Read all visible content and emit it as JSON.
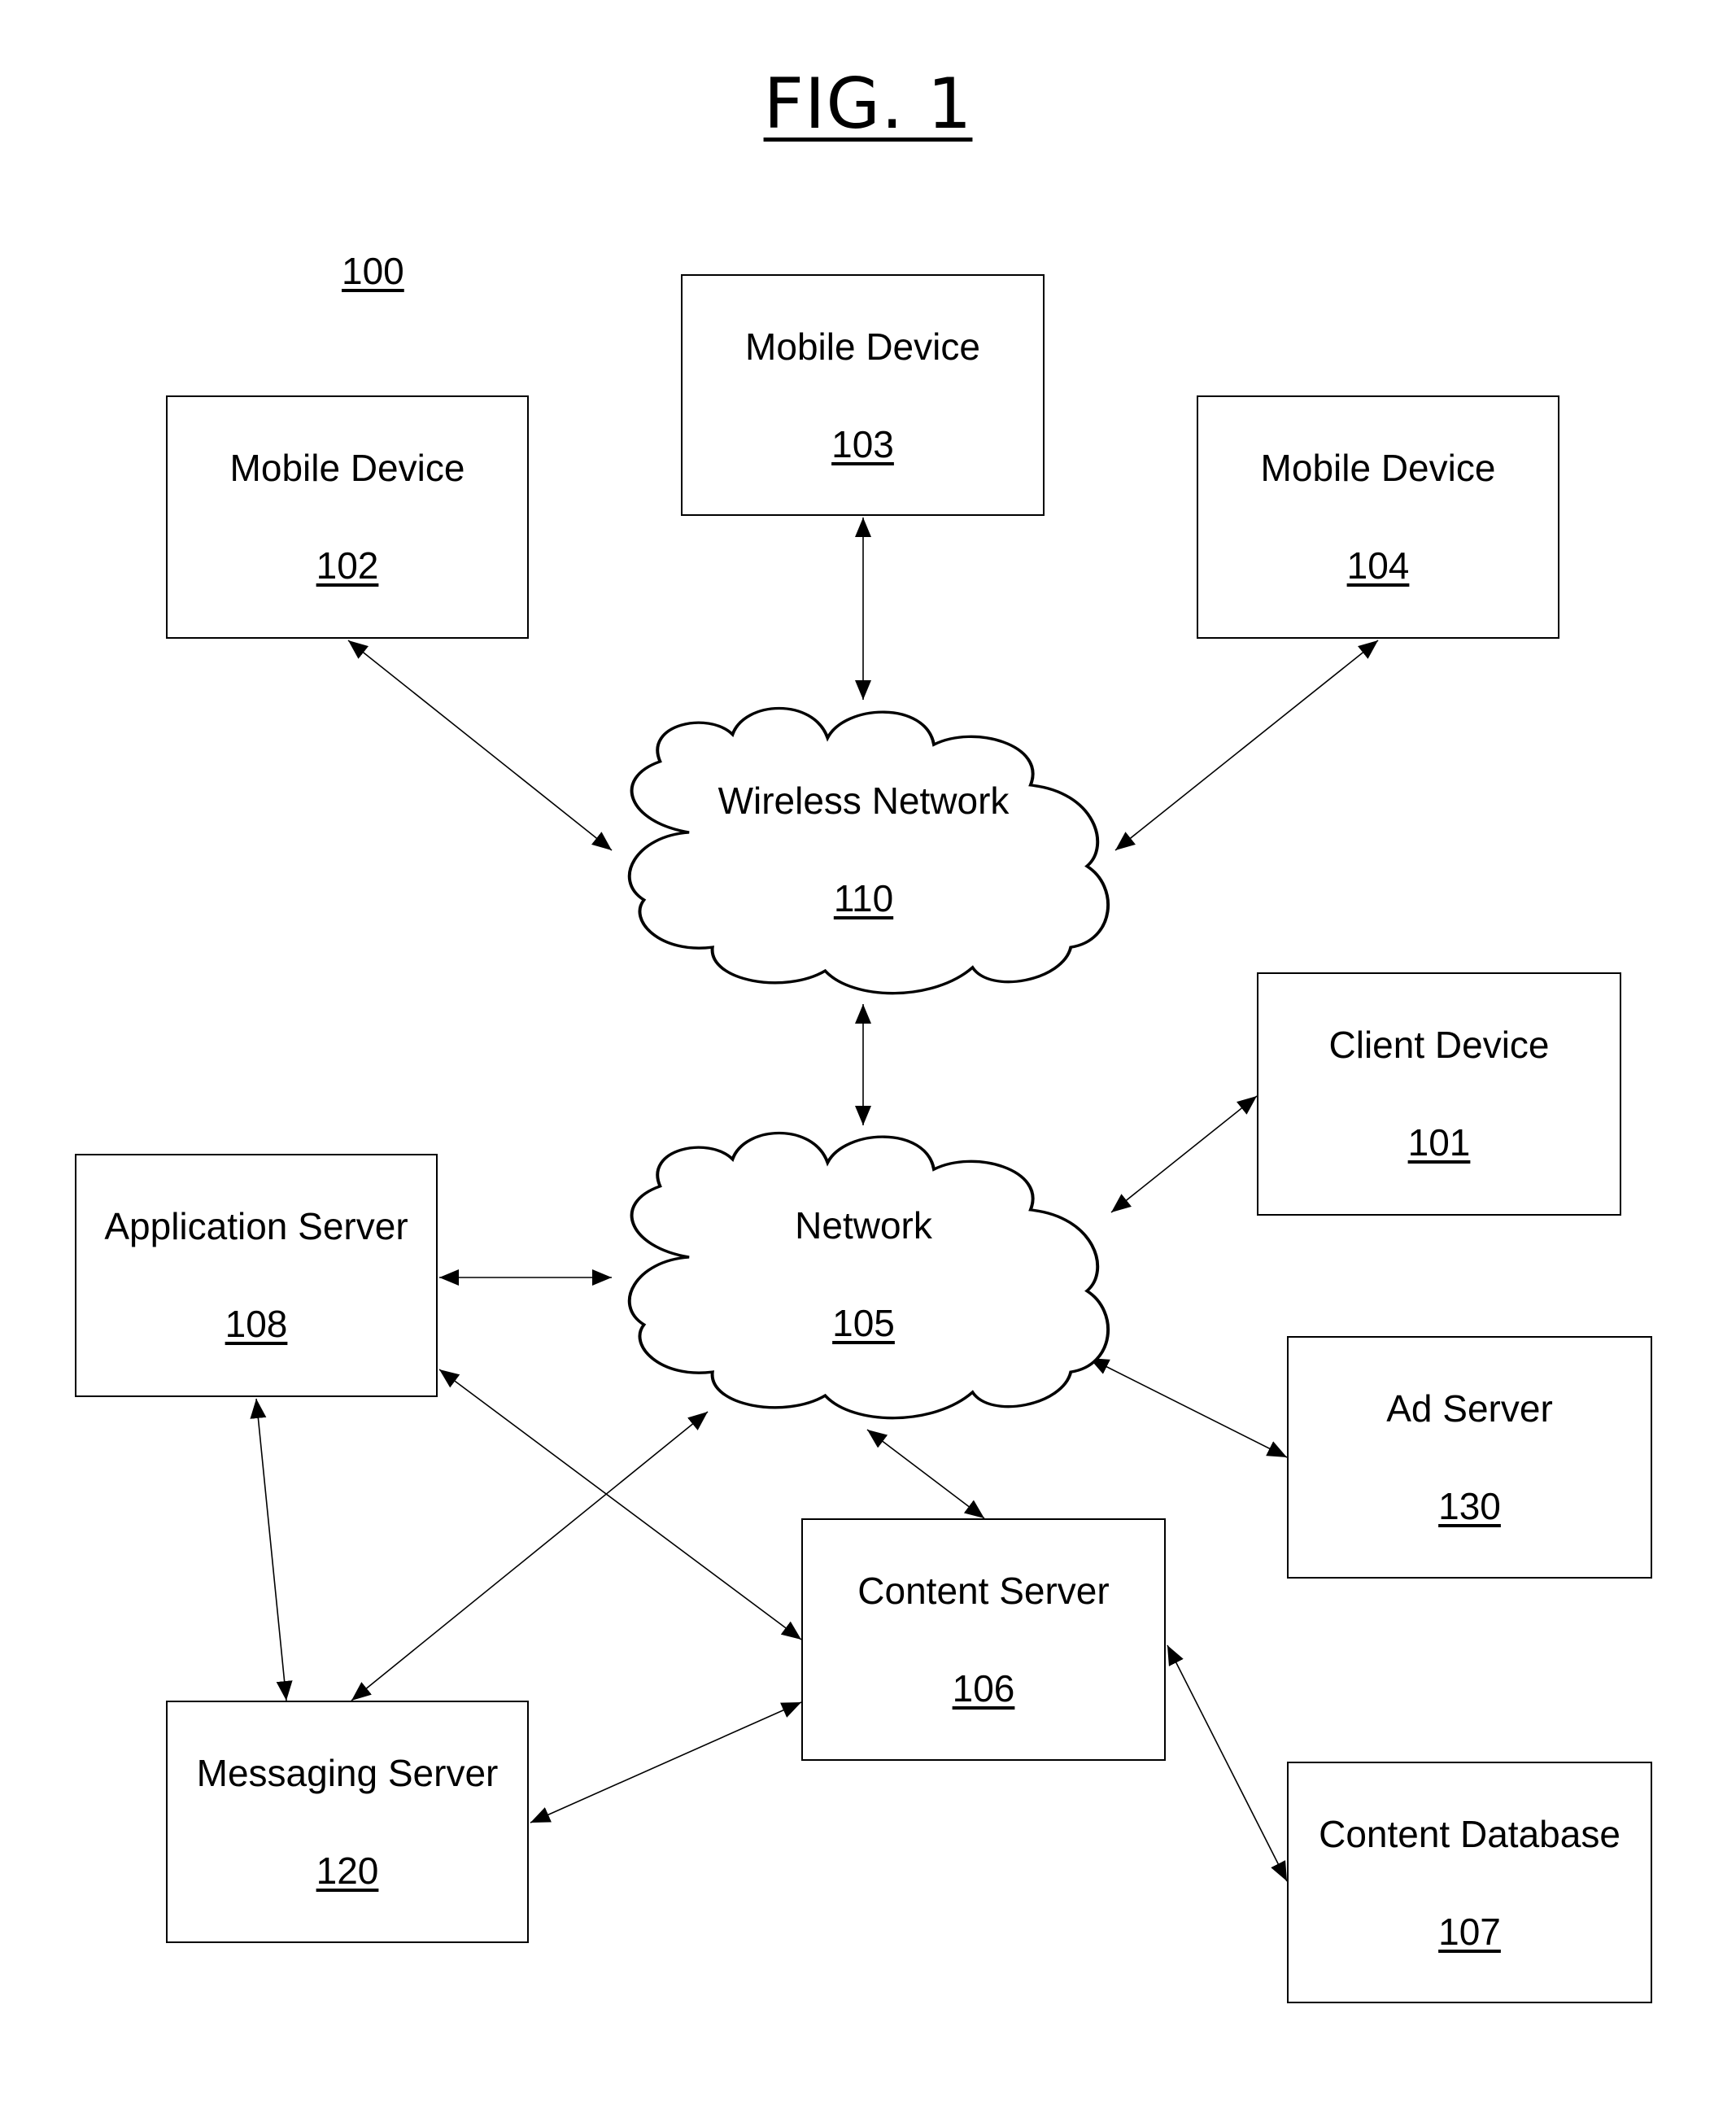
{
  "figure": {
    "title": "FIG. 1",
    "system_ref": "100"
  },
  "nodes": {
    "mobile_103": {
      "name": "Mobile Device",
      "ref": "103"
    },
    "mobile_102": {
      "name": "Mobile Device",
      "ref": "102"
    },
    "mobile_104": {
      "name": "Mobile Device",
      "ref": "104"
    },
    "wireless_network": {
      "name": "Wireless Network",
      "ref": "110"
    },
    "network": {
      "name": "Network",
      "ref": "105"
    },
    "client_device": {
      "name": "Client Device",
      "ref": "101"
    },
    "application_server": {
      "name": "Application Server",
      "ref": "108"
    },
    "ad_server": {
      "name": "Ad Server",
      "ref": "130"
    },
    "content_server": {
      "name": "Content Server",
      "ref": "106"
    },
    "messaging_server": {
      "name": "Messaging Server",
      "ref": "120"
    },
    "content_database": {
      "name": "Content Database",
      "ref": "107"
    }
  },
  "connections": [
    {
      "from": "mobile_102",
      "to": "wireless_network",
      "bidirectional": true
    },
    {
      "from": "mobile_103",
      "to": "wireless_network",
      "bidirectional": true
    },
    {
      "from": "mobile_104",
      "to": "wireless_network",
      "bidirectional": true
    },
    {
      "from": "wireless_network",
      "to": "network",
      "bidirectional": true
    },
    {
      "from": "client_device",
      "to": "network",
      "bidirectional": true
    },
    {
      "from": "application_server",
      "to": "network",
      "bidirectional": true
    },
    {
      "from": "ad_server",
      "to": "network",
      "bidirectional": true
    },
    {
      "from": "content_server",
      "to": "network",
      "bidirectional": true
    },
    {
      "from": "messaging_server",
      "to": "network",
      "bidirectional": true
    },
    {
      "from": "application_server",
      "to": "content_server",
      "bidirectional": true
    },
    {
      "from": "application_server",
      "to": "messaging_server",
      "bidirectional": true
    },
    {
      "from": "messaging_server",
      "to": "content_server",
      "bidirectional": true
    },
    {
      "from": "content_server",
      "to": "content_database",
      "bidirectional": true
    }
  ]
}
